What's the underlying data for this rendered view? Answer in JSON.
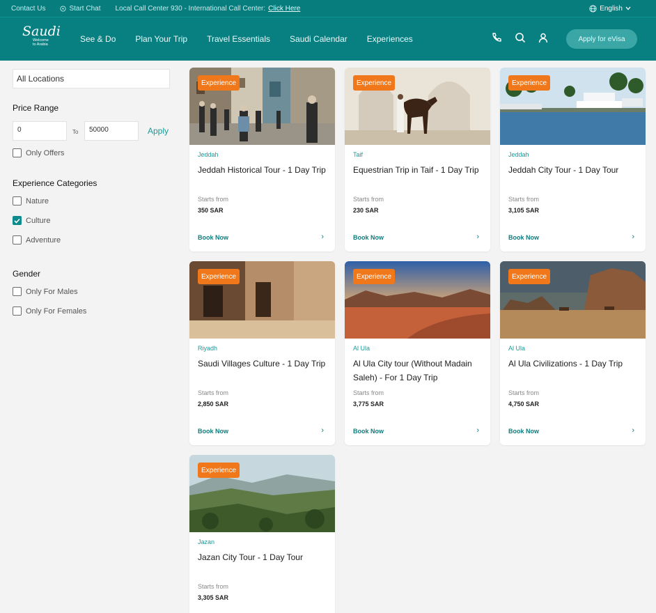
{
  "topbar": {
    "contact": "Contact Us",
    "chat": "Start Chat",
    "callcenter_text": "Local Call Center 930 - International Call Center:",
    "callcenter_link": "Click Here",
    "language": "English"
  },
  "nav": {
    "logo_title": "Saudi",
    "logo_sub1": "Welcome",
    "logo_sub2": "to Arabia",
    "items": [
      "See & Do",
      "Plan Your Trip",
      "Travel Essentials",
      "Saudi Calendar",
      "Experiences"
    ],
    "cta": "Apply for eVisa"
  },
  "sidebar": {
    "location_value": "All Locations",
    "price_heading": "Price Range",
    "price_from": "0",
    "price_to_label": "To",
    "price_to": "50000",
    "apply": "Apply",
    "only_offers": "Only Offers",
    "categories_heading": "Experience Categories",
    "categories": [
      {
        "label": "Nature",
        "checked": false
      },
      {
        "label": "Culture",
        "checked": true
      },
      {
        "label": "Adventure",
        "checked": false
      }
    ],
    "gender_heading": "Gender",
    "gender": [
      {
        "label": "Only For Males"
      },
      {
        "label": "Only For Females"
      }
    ]
  },
  "cards": [
    {
      "badge": "Experience",
      "city": "Jeddah",
      "title": "Jeddah Historical Tour - 1 Day Trip",
      "starts": "Starts from",
      "price": "350 SAR",
      "book": "Book Now",
      "image": "historic-street"
    },
    {
      "badge": "Experience",
      "city": "Taif",
      "title": "Equestrian Trip in Taif - 1 Day Trip",
      "starts": "Starts from",
      "price": "230 SAR",
      "book": "Book Now",
      "image": "horse-arches"
    },
    {
      "badge": "Experience",
      "city": "Jeddah",
      "title": "Jeddah City Tour - 1 Day Tour",
      "starts": "Starts from",
      "price": "3,105 SAR",
      "book": "Book Now",
      "image": "marina"
    },
    {
      "badge": "Experience",
      "city": "Riyadh",
      "title": "Saudi Villages Culture - 1 Day Trip",
      "starts": "Starts from",
      "price": "2,850 SAR",
      "book": "Book Now",
      "image": "mud-village"
    },
    {
      "badge": "Experience",
      "city": "Al Ula",
      "title": "Al Ula City tour (Without Madain Saleh) - For 1 Day Trip",
      "starts": "Starts from",
      "price": "3,775 SAR",
      "book": "Book Now",
      "image": "desert-canyon"
    },
    {
      "badge": "Experience",
      "city": "Al Ula",
      "title": "Al Ula Civilizations - 1 Day Trip",
      "starts": "Starts from",
      "price": "4,750 SAR",
      "book": "Book Now",
      "image": "desert-camels"
    },
    {
      "badge": "Experience",
      "city": "Jazan",
      "title": "Jazan City Tour - 1 Day Tour",
      "starts": "Starts from",
      "price": "3,305 SAR",
      "book": "Book Now",
      "image": "mountain-valley"
    }
  ]
}
